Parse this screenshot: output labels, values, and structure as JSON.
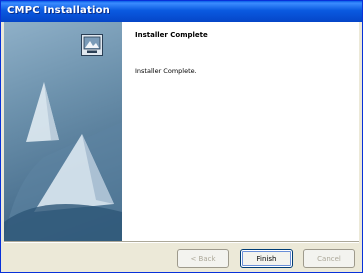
{
  "window": {
    "title": "CMPC Installation"
  },
  "header": {
    "title": "Installer Complete"
  },
  "body": {
    "message": "Installer Complete."
  },
  "buttons": {
    "back": "< Back",
    "finish": "Finish",
    "cancel": "Cancel"
  },
  "colors": {
    "titlebar": "#0a5ae0",
    "dialog_bg": "#ece9d8",
    "panel_blue": "#4f7593"
  },
  "icons": {
    "logo": "installer-logo-icon"
  }
}
